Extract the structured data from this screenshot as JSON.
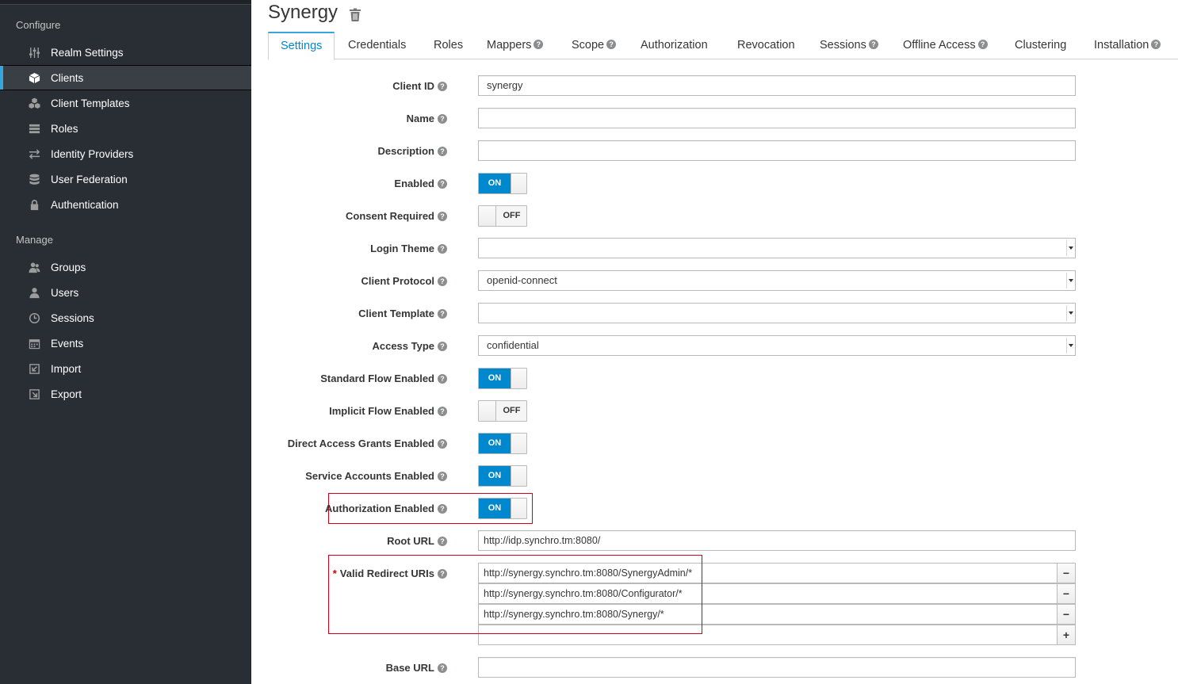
{
  "sidebar": {
    "configure_title": "Configure",
    "manage_title": "Manage",
    "configure_items": [
      {
        "label": "Realm Settings",
        "icon": "sliders-icon"
      },
      {
        "label": "Clients",
        "icon": "cube-icon",
        "active": true
      },
      {
        "label": "Client Templates",
        "icon": "cubes-icon"
      },
      {
        "label": "Roles",
        "icon": "list-icon"
      },
      {
        "label": "Identity Providers",
        "icon": "exchange-icon"
      },
      {
        "label": "User Federation",
        "icon": "database-icon"
      },
      {
        "label": "Authentication",
        "icon": "lock-icon"
      }
    ],
    "manage_items": [
      {
        "label": "Groups",
        "icon": "users-icon"
      },
      {
        "label": "Users",
        "icon": "user-icon"
      },
      {
        "label": "Sessions",
        "icon": "clock-icon"
      },
      {
        "label": "Events",
        "icon": "calendar-icon"
      },
      {
        "label": "Import",
        "icon": "import-icon"
      },
      {
        "label": "Export",
        "icon": "export-icon"
      }
    ]
  },
  "header": {
    "title": "Synergy"
  },
  "tabs": [
    {
      "label": "Settings",
      "active": true,
      "help": false
    },
    {
      "label": "Credentials",
      "help": false
    },
    {
      "label": "Roles",
      "help": false
    },
    {
      "label": "Mappers",
      "help": true
    },
    {
      "label": "Scope",
      "help": true
    },
    {
      "label": "Authorization",
      "help": false
    },
    {
      "label": "Revocation",
      "help": false
    },
    {
      "label": "Sessions",
      "help": true
    },
    {
      "label": "Offline Access",
      "help": true
    },
    {
      "label": "Clustering",
      "help": false
    },
    {
      "label": "Installation",
      "help": true
    }
  ],
  "form": {
    "client_id": {
      "label": "Client ID",
      "value": "synergy"
    },
    "name": {
      "label": "Name",
      "value": ""
    },
    "description": {
      "label": "Description",
      "value": ""
    },
    "enabled": {
      "label": "Enabled",
      "state": "ON"
    },
    "consent_required": {
      "label": "Consent Required",
      "state": "OFF"
    },
    "login_theme": {
      "label": "Login Theme",
      "value": ""
    },
    "client_protocol": {
      "label": "Client Protocol",
      "value": "openid-connect"
    },
    "client_template": {
      "label": "Client Template",
      "value": ""
    },
    "access_type": {
      "label": "Access Type",
      "value": "confidential"
    },
    "standard_flow": {
      "label": "Standard Flow Enabled",
      "state": "ON"
    },
    "implicit_flow": {
      "label": "Implicit Flow Enabled",
      "state": "OFF"
    },
    "direct_access": {
      "label": "Direct Access Grants Enabled",
      "state": "ON"
    },
    "service_accounts": {
      "label": "Service Accounts Enabled",
      "state": "ON"
    },
    "authorization": {
      "label": "Authorization Enabled",
      "state": "ON"
    },
    "root_url": {
      "label": "Root URL",
      "value": "http://idp.synchro.tm:8080/"
    },
    "redirect_uris": {
      "label": "Valid Redirect URIs",
      "required_mark": "*",
      "values": [
        "http://synergy.synchro.tm:8080/SynergyAdmin/*",
        "http://synergy.synchro.tm:8080/Configurator/*",
        "http://synergy.synchro.tm:8080/Synergy/*",
        ""
      ],
      "remove_label": "−",
      "add_label": "+"
    },
    "base_url": {
      "label": "Base URL",
      "value": ""
    }
  },
  "colors": {
    "sidebar_bg": "#292e34",
    "accent": "#0088ce",
    "highlight_box": "#d0021b"
  }
}
